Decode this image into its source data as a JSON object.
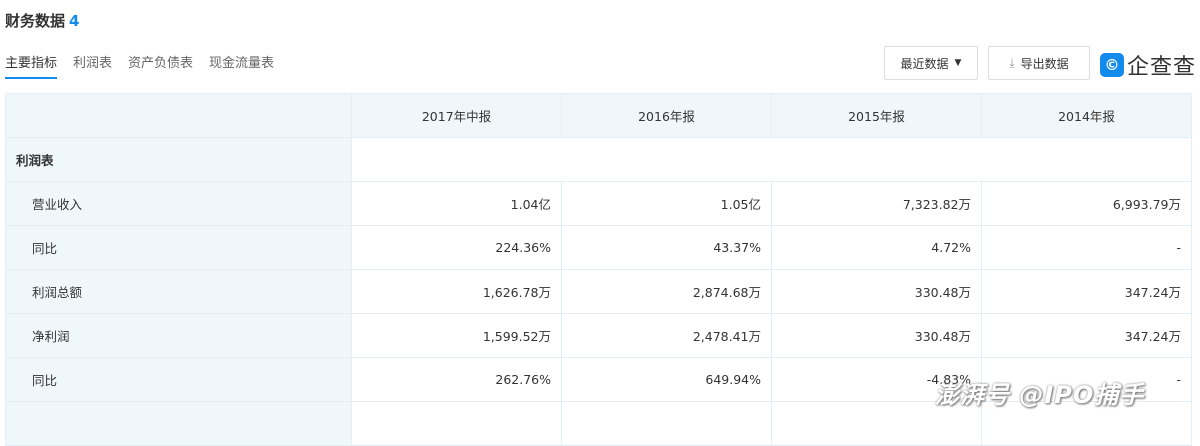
{
  "header": {
    "title": "财务数据",
    "count": "4"
  },
  "tabs": [
    "主要指标",
    "利润表",
    "资产负债表",
    "现金流量表"
  ],
  "toolbar": {
    "period_select": "最近数据",
    "export": "导出数据",
    "brand": "企查查"
  },
  "table": {
    "columns": [
      "2017年中报",
      "2016年报",
      "2015年报",
      "2014年报"
    ],
    "section": "利润表",
    "rows": [
      {
        "label": "营业收入",
        "values": [
          "1.04亿",
          "1.05亿",
          "7,323.82万",
          "6,993.79万"
        ]
      },
      {
        "label": "同比",
        "values": [
          "224.36%",
          "43.37%",
          "4.72%",
          "-"
        ]
      },
      {
        "label": "利润总额",
        "values": [
          "1,626.78万",
          "2,874.68万",
          "330.48万",
          "347.24万"
        ]
      },
      {
        "label": "净利润",
        "values": [
          "1,599.52万",
          "2,478.41万",
          "330.48万",
          "347.24万"
        ]
      },
      {
        "label": "同比",
        "values": [
          "262.76%",
          "649.94%",
          "-4.83%",
          "-"
        ]
      }
    ]
  },
  "watermark": "澎湃号 @IPO捕手"
}
